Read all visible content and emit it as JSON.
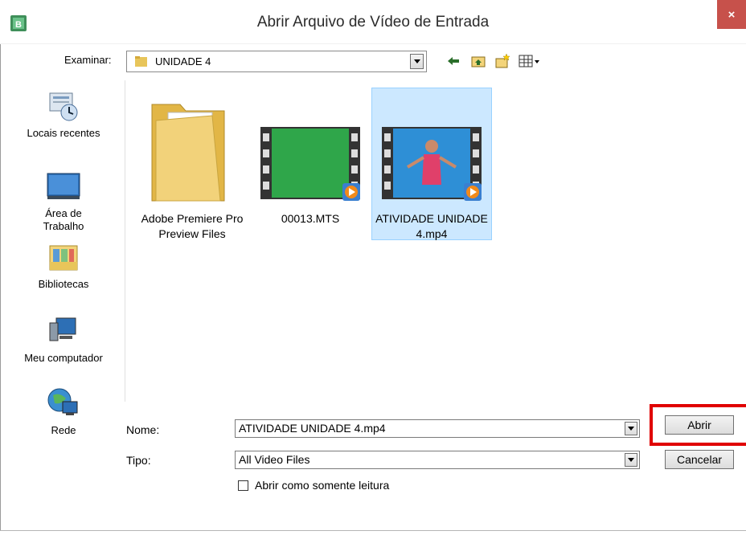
{
  "window": {
    "title": "Abrir Arquivo de Vídeo de Entrada",
    "close_label": "×"
  },
  "lookin": {
    "label": "Examinar:",
    "value": "UNIDADE 4"
  },
  "toolbar": {
    "icons": [
      "back-icon",
      "up-folder-icon",
      "new-folder-icon",
      "view-menu-icon"
    ]
  },
  "places": [
    {
      "label": "Locais recentes",
      "icon": "recent-places-icon"
    },
    {
      "label": "Área de Trabalho",
      "icon": "desktop-icon"
    },
    {
      "label": "Bibliotecas",
      "icon": "libraries-icon"
    },
    {
      "label": "Meu computador",
      "icon": "computer-icon"
    },
    {
      "label": "Rede",
      "icon": "network-icon"
    }
  ],
  "files": [
    {
      "name": "Adobe Premiere Pro Preview Files",
      "type": "folder",
      "selected": false
    },
    {
      "name": "00013.MTS",
      "type": "video",
      "selected": false
    },
    {
      "name": "ATIVIDADE UNIDADE 4.mp4",
      "type": "video",
      "selected": true
    }
  ],
  "form": {
    "name_label": "Nome:",
    "name_value": "ATIVIDADE UNIDADE 4.mp4",
    "type_label": "Tipo:",
    "type_value": "All Video Files",
    "readonly_label": "Abrir como somente leitura",
    "readonly_checked": false
  },
  "buttons": {
    "open": "Abrir",
    "cancel": "Cancelar"
  },
  "colors": {
    "close_button": "#c7514b",
    "selection": "#cce8ff",
    "highlight": "#e00000"
  }
}
